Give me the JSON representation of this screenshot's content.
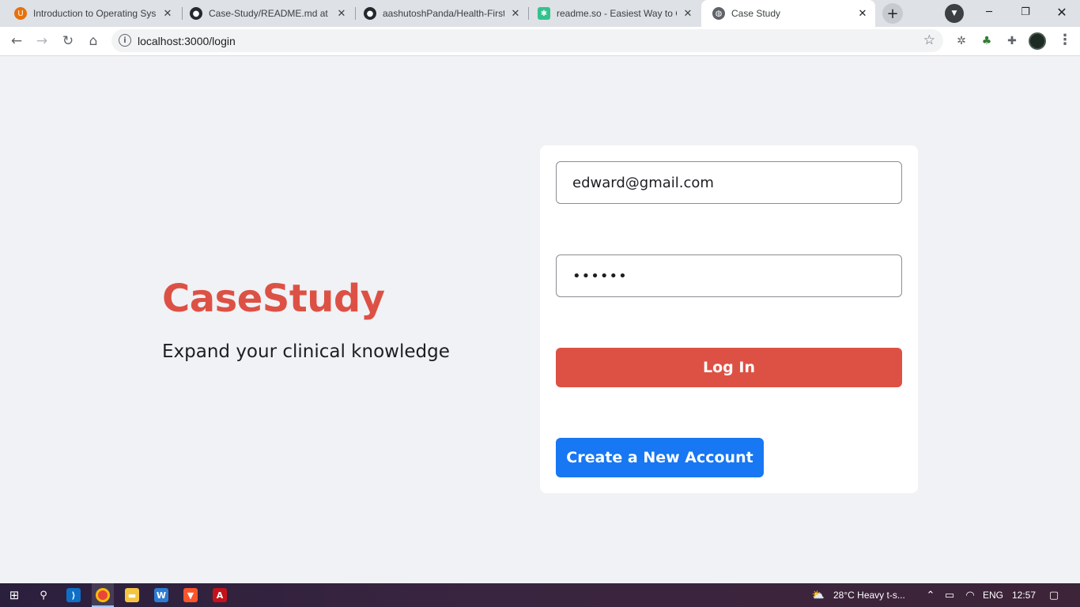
{
  "browser": {
    "tabs": [
      {
        "title": "Introduction to Operating Sys",
        "icon": "udemy-icon",
        "color": "#e8710a"
      },
      {
        "title": "Case-Study/README.md at m",
        "icon": "github-icon",
        "color": "#24292f"
      },
      {
        "title": "aashutoshPanda/Health-First",
        "icon": "github-icon",
        "color": "#24292f"
      },
      {
        "title": "readme.so - Easiest Way to C",
        "icon": "readme-icon",
        "color": "#33c28e"
      },
      {
        "title": "Case Study",
        "icon": "globe-icon",
        "color": "#5f6368",
        "active": true
      }
    ],
    "url": "localhost:3000/login"
  },
  "page": {
    "brand": "CaseStudy",
    "tagline": "Expand your clinical knowledge",
    "email_value": "edward@gmail.com",
    "password_value": "••••••",
    "login_label": "Log In",
    "create_label": "Create a New Account"
  },
  "taskbar": {
    "weather": "28°C  Heavy t-s...",
    "language": "ENG",
    "time": "12:57"
  },
  "colors": {
    "brand": "#dd5145",
    "primary": "#1877f2",
    "background": "#f0f2f5"
  }
}
